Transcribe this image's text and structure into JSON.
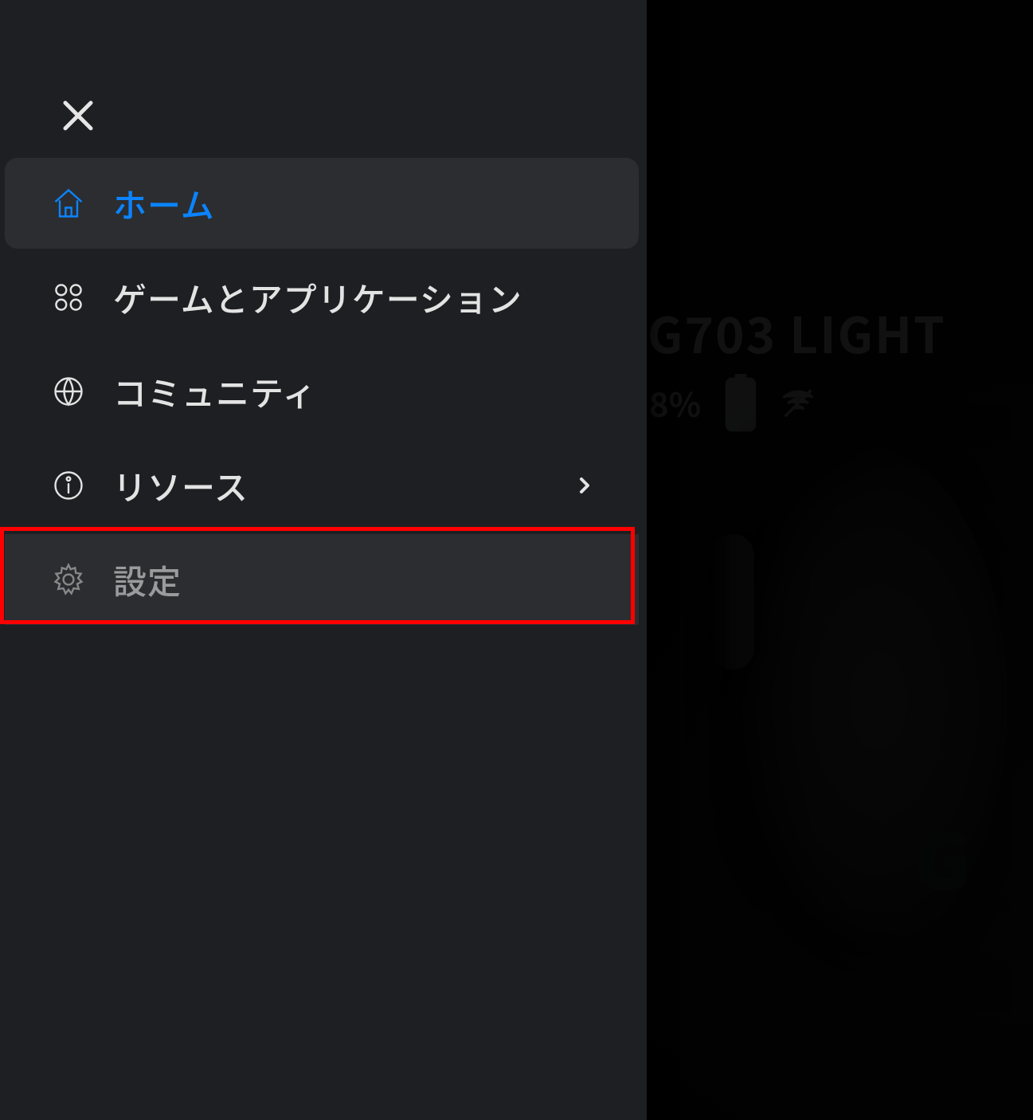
{
  "device": {
    "title_fragment": "G703 LIGHT",
    "battery_percent_fragment": "8%"
  },
  "drawer": {
    "items": [
      {
        "label": "ホーム",
        "icon": "home",
        "active": true,
        "has_chevron": false
      },
      {
        "label": "ゲームとアプリケーション",
        "icon": "apps",
        "active": false,
        "has_chevron": false
      },
      {
        "label": "コミュニティ",
        "icon": "globe",
        "active": false,
        "has_chevron": false
      },
      {
        "label": "リソース",
        "icon": "info",
        "active": false,
        "has_chevron": true
      },
      {
        "label": "設定",
        "icon": "settings",
        "active": false,
        "has_chevron": false
      }
    ]
  }
}
